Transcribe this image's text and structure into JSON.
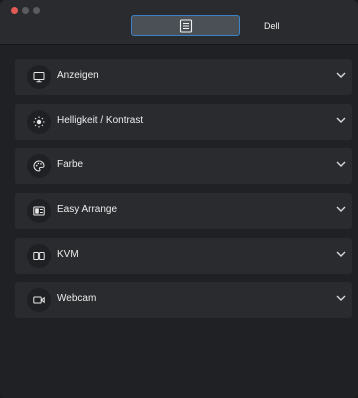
{
  "window": {
    "controls": [
      "close",
      "minimize",
      "zoom"
    ]
  },
  "header": {
    "tab_icon": "document-icon",
    "monitor_name": "Dell"
  },
  "sections": [
    {
      "label": "Anzeigen",
      "icon": "monitor-icon"
    },
    {
      "label": "Helligkeit / Kontrast",
      "icon": "brightness-icon"
    },
    {
      "label": "Farbe",
      "icon": "palette-icon"
    },
    {
      "label": "Easy Arrange",
      "icon": "layout-icon"
    },
    {
      "label": "KVM",
      "icon": "kvm-icon"
    },
    {
      "label": "Webcam",
      "icon": "webcam-icon"
    }
  ],
  "colors": {
    "accent": "#3c82c7",
    "row_bg": "#2a2b2e",
    "window_bg": "#202124"
  }
}
